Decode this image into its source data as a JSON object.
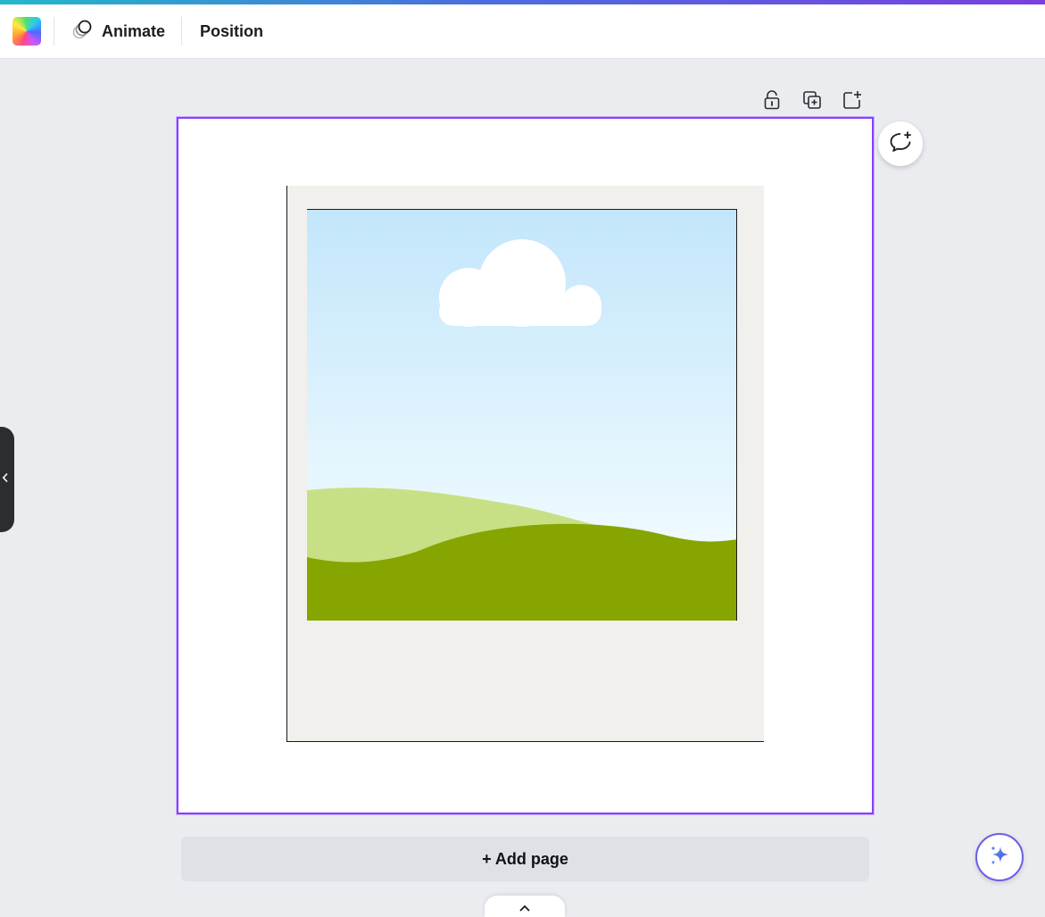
{
  "toolbar": {
    "color_swatch_icon": "color-picker-icon",
    "animate": {
      "label": "Animate",
      "icon": "animate-circles-icon"
    },
    "position": {
      "label": "Position"
    }
  },
  "page_actions": [
    {
      "icon": "unlock-icon"
    },
    {
      "icon": "duplicate-page-icon"
    },
    {
      "icon": "add-page-icon"
    }
  ],
  "canvas": {
    "selected": true,
    "accent_color": "#8b3dff",
    "image": {
      "description_icon": "polaroid-landscape-illustration",
      "sky_top": "#c3e6fb",
      "sky_bottom": "#f3fbff",
      "hill_light": "#c7e085",
      "hill_dark": "#87a500",
      "frame_color": "#f2f0ed"
    }
  },
  "comment_button": {
    "icon": "add-comment-icon"
  },
  "side_panel_toggle": {
    "icon": "chevron-left-icon"
  },
  "add_page": {
    "label": "+ Add page"
  },
  "bottom_tab": {
    "icon": "chevron-up-icon"
  },
  "magic_button": {
    "icon": "sparkle-icon",
    "accent": "#6a5ee8"
  }
}
